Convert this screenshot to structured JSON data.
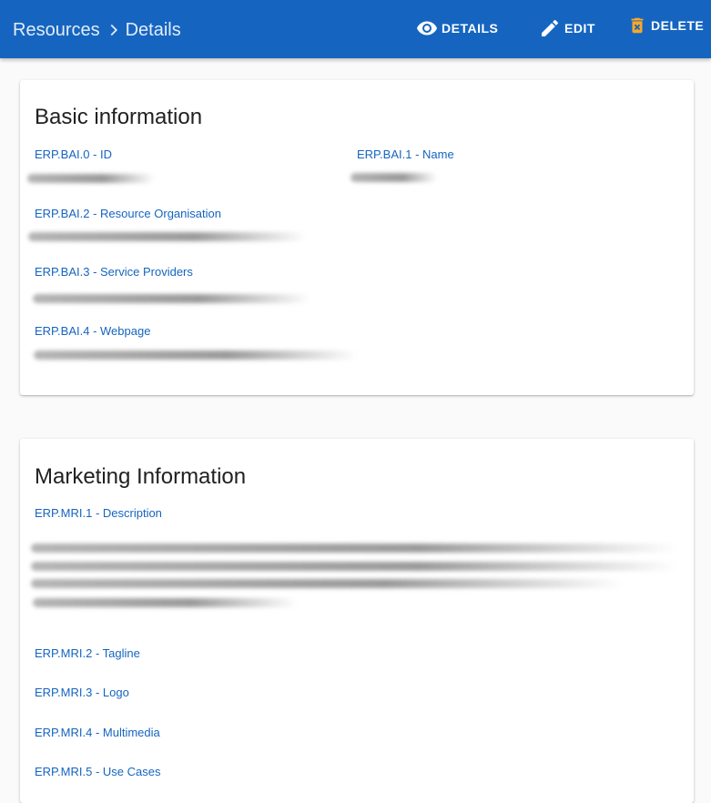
{
  "header": {
    "breadcrumb_root": "Resources",
    "breadcrumb_current": "Details",
    "actions": {
      "details": "DETAILS",
      "edit": "EDIT",
      "delete": "DELETE"
    },
    "colors": {
      "bar": "#1565c0",
      "text": "#ffffff"
    }
  },
  "basic_information": {
    "title": "Basic information",
    "fields": [
      {
        "label": "ERP.BAI.0 - ID"
      },
      {
        "label": "ERP.BAI.1 - Name"
      },
      {
        "label": "ERP.BAI.2 - Resource Organisation"
      },
      {
        "label": "ERP.BAI.3 - Service Providers"
      },
      {
        "label": "ERP.BAI.4 - Webpage"
      }
    ]
  },
  "marketing_information": {
    "title": "Marketing Information",
    "fields": [
      {
        "label": "ERP.MRI.1 - Description"
      },
      {
        "label": "ERP.MRI.2 - Tagline"
      },
      {
        "label": "ERP.MRI.3 - Logo"
      },
      {
        "label": "ERP.MRI.4 - Multimedia"
      },
      {
        "label": "ERP.MRI.5 - Use Cases"
      }
    ]
  },
  "icons": {
    "breadcrumb_separator": "chevron-right-icon",
    "details": "eye-icon",
    "edit": "pencil-icon",
    "delete": "delete-icon"
  }
}
